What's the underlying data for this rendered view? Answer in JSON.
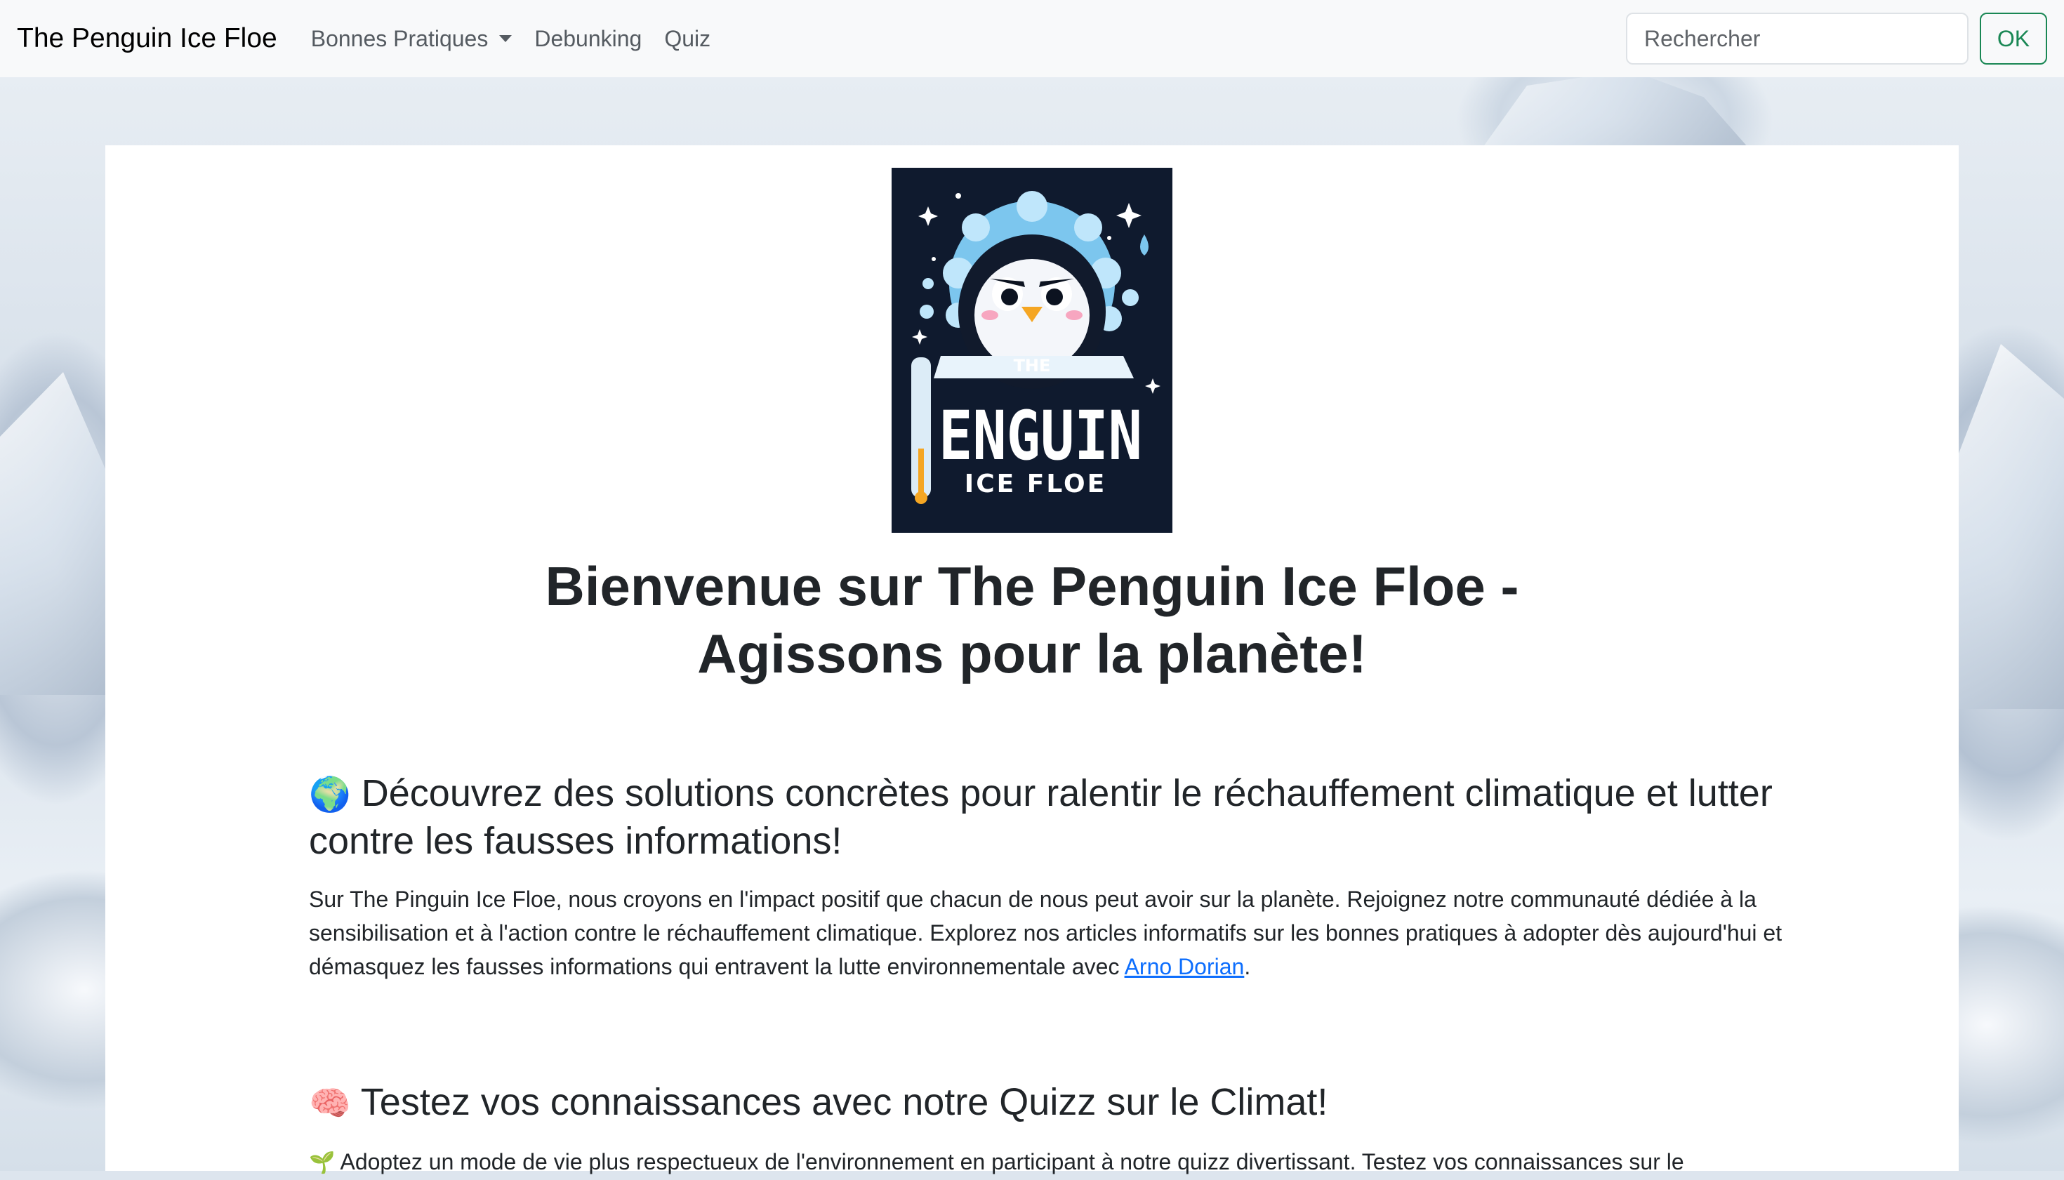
{
  "navbar": {
    "brand": "The Penguin Ice Floe",
    "items": [
      {
        "label": "Bonnes Pratiques",
        "dropdown": true
      },
      {
        "label": "Debunking",
        "dropdown": false
      },
      {
        "label": "Quiz",
        "dropdown": false
      }
    ],
    "search": {
      "placeholder": "Rechercher",
      "value": ""
    },
    "submit_label": "OK"
  },
  "hero": {
    "logo": {
      "top_text": "THE",
      "main_text": "ENGUIN",
      "sub_text": "ICE FLOE"
    },
    "title_line1": "Bienvenue sur The Penguin Ice Floe -",
    "title_line2": "Agissons pour la planète!"
  },
  "sections": [
    {
      "emoji": "🌍",
      "heading": "Découvrez des solutions concrètes pour ralentir le réchauffement climatique et lutter contre les fausses informations!",
      "body_before_link": "Sur The Pinguin Ice Floe, nous croyons en l'impact positif que chacun de nous peut avoir sur la planète. Rejoignez notre communauté dédiée à la sensibilisation et à l'action contre le réchauffement climatique. Explorez nos articles informatifs sur les bonnes pratiques à adopter dès aujourd'hui et démasquez les fausses informations qui entravent la lutte environnementale avec",
      "link_text": "Arno Dorian",
      "body_after_link": "."
    },
    {
      "emoji": "🧠",
      "heading": "Testez vos connaissances avec notre Quizz sur le Climat!",
      "body_emoji": "🌱",
      "body": "Adoptez un mode de vie plus respectueux de l'environnement en participant à notre quizz divertissant. Testez vos connaissances sur le"
    }
  ],
  "colors": {
    "navbar_bg": "#f8f9fa",
    "success": "#198754",
    "link": "#0d6efd",
    "logo_bg": "#0f1a2e"
  }
}
